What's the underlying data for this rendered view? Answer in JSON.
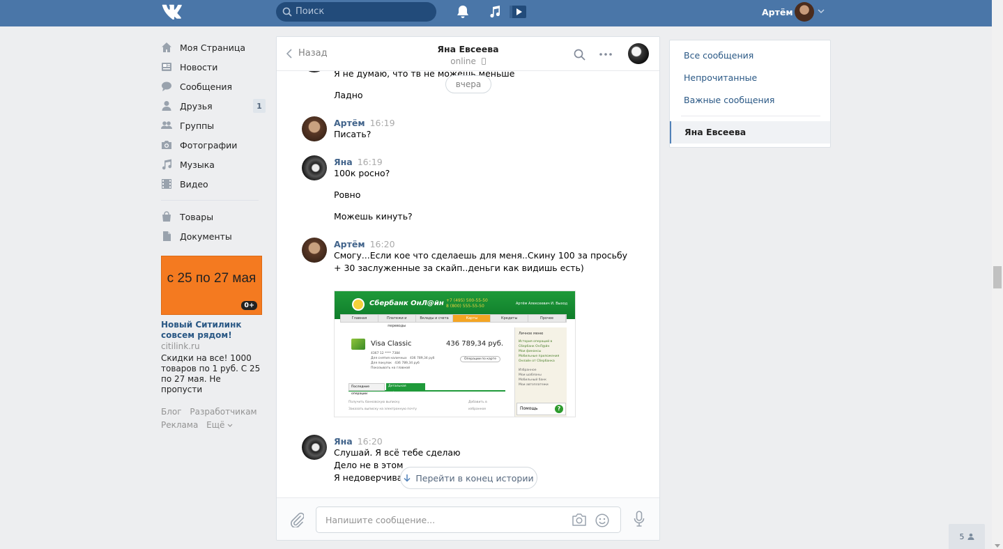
{
  "header": {
    "search_placeholder": "Поиск",
    "user_name": "Артём"
  },
  "nav": {
    "items": [
      {
        "label": "Моя Страница"
      },
      {
        "label": "Новости"
      },
      {
        "label": "Сообщения"
      },
      {
        "label": "Друзья",
        "badge": "1"
      },
      {
        "label": "Группы"
      },
      {
        "label": "Фотографии"
      },
      {
        "label": "Музыка"
      },
      {
        "label": "Видео"
      }
    ],
    "items2": [
      {
        "label": "Товары"
      },
      {
        "label": "Документы"
      }
    ]
  },
  "ad": {
    "banner_text": "с 25 по 27 мая",
    "age": "0+",
    "title": "Новый Ситилинк совсем рядом!",
    "domain": "citilink.ru",
    "text": "Скидки на все! 1000 товаров по 1 руб. С 25 по 27 мая. Не пропусти"
  },
  "footer": {
    "links": [
      "Блог",
      "Разработчикам",
      "Реклама",
      "Ещё"
    ]
  },
  "chat": {
    "back_label": "Назад",
    "peer_name": "Яна Евсеева",
    "peer_status": "online",
    "day_label": "вчера",
    "jump_label": "Перейти в конец истории",
    "composer_placeholder": "Напишите сообщение...",
    "partial_lines": [
      "Я не думаю, что тв не можешь меньше",
      "Ладно"
    ],
    "groups": [
      {
        "author": "Артём",
        "time": "16:19",
        "lines": [
          "Писать?"
        ]
      },
      {
        "author": "Яна",
        "time": "16:19",
        "lines": [
          "100к росно?",
          "Ровно",
          "Можешь кинуть?"
        ]
      },
      {
        "author": "Артём",
        "time": "16:20",
        "lines": [
          "Смогу...Если кое что сделаешь для меня..Скину 100 за просьбу",
          "+ 30 заслуженные за скайп..деньги как видишь есть)"
        ]
      },
      {
        "author": "Яна",
        "time": "16:20",
        "lines": [
          "Слушай. Я всё тебе сделаю",
          "Дело не в этом",
          "Я недоверчива"
        ]
      }
    ],
    "photo": {
      "brand": "Сбербанк ОнЛ@йн",
      "phone": "+7 (495) 500-55-50\n8 (800) 555-55-50",
      "user": "Артём Алексеевич И.   Выход",
      "tabs": [
        "Главная",
        "Платежи и переводы",
        "Вклады и счета",
        "Карты",
        "Кредиты",
        "Прочее"
      ],
      "card_name": "Visa Classic",
      "card_sum": "436 789,34 руб.",
      "card_details": "4367 12 **** 7384\nДля снятия наличных   436 789,34 руб\nДля покупок   436 789,34 руб\nПоказывать на главной",
      "card_button": "Операции по карте",
      "side_title": "Личное меню",
      "side_links": [
        "История операций в Сбербанк ОнЛ@йн",
        "Мои финансы",
        "Мобильные приложения",
        "Онлайн от Сбербанка",
        "Избранное",
        "Мои шаблоны",
        "Мобильный банк",
        "Мои автоплатежи"
      ],
      "help": "Помощь",
      "tab_a": "Последние операции",
      "tab_b": "Детальная информация",
      "row_a": "Получить банковскую выписку",
      "row_b": "Заказать выписку на электронную почту",
      "row_c": "Добавить в избранное"
    }
  },
  "right": {
    "items": [
      "Все сообщения",
      "Непрочитанные",
      "Важные сообщения"
    ],
    "active": "Яна Евсеева"
  },
  "online_count": "5",
  "colors": {
    "brand": "#4a76a8",
    "accent_link": "#2a5885",
    "ad_orange": "#f47a20"
  }
}
